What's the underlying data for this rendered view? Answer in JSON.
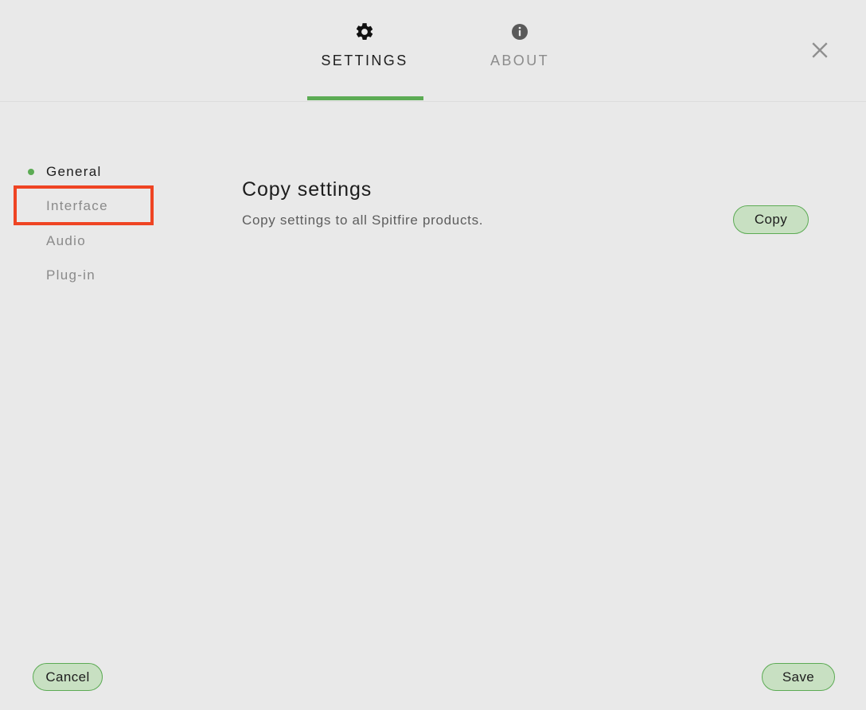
{
  "window": {
    "background_color": "#e9e9e9",
    "accent_color": "#5cab54",
    "button_fill_color": "#c8e0c2",
    "highlight_color": "#ef4423"
  },
  "header": {
    "tabs": [
      {
        "label": "SETTINGS",
        "icon": "gear-icon",
        "active": true
      },
      {
        "label": "ABOUT",
        "icon": "info-icon",
        "active": false
      }
    ],
    "close_icon": "close-icon"
  },
  "sidebar": {
    "items": [
      {
        "label": "General",
        "active": true,
        "bullet": true
      },
      {
        "label": "Interface",
        "active": false,
        "bullet": false,
        "highlighted": true
      },
      {
        "label": "Audio",
        "active": false,
        "bullet": false
      },
      {
        "label": "Plug-in",
        "active": false,
        "bullet": false
      }
    ]
  },
  "main": {
    "settings": [
      {
        "title": "Copy settings",
        "description": "Copy settings to all Spitfire products.",
        "action_label": "Copy"
      }
    ]
  },
  "footer": {
    "cancel_label": "Cancel",
    "save_label": "Save"
  }
}
